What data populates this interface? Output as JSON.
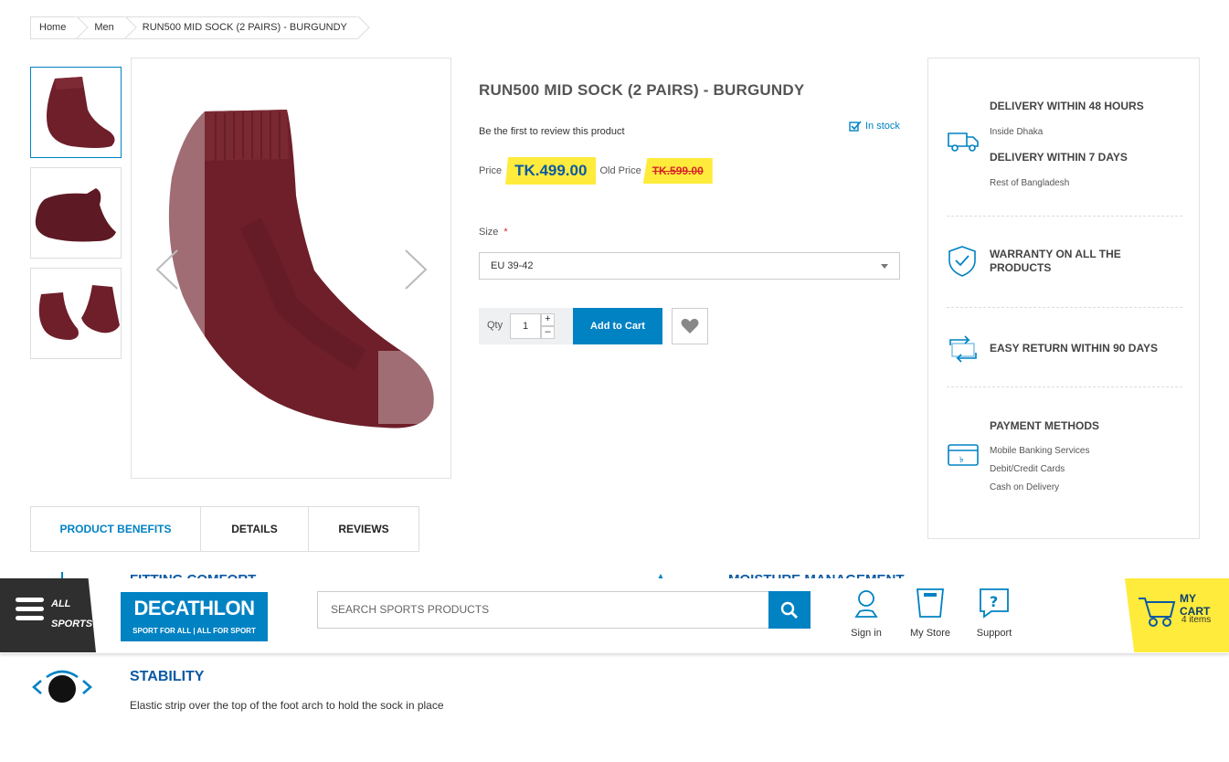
{
  "breadcrumb": {
    "home": "Home",
    "category": "Men",
    "current": "RUN500 MID SOCK (2 PAIRS) - BURGUNDY"
  },
  "product": {
    "title": "RUN500 MID SOCK (2 PAIRS) - BURGUNDY",
    "review_link": "Be the first to review this product",
    "stock": "In stock",
    "price_label": "Price",
    "price": "TK.499.00",
    "old_price_label": "Old Price",
    "old_price": "TK.599.00",
    "size_label": "Size",
    "size_required": "*",
    "size_value": "EU 39-42",
    "qty_label": "Qty",
    "qty_value": "1",
    "qty_plus": "+",
    "qty_minus": "–",
    "add_to_cart": "Add to Cart"
  },
  "info_panel": {
    "delivery_title_1": "DELIVERY WITHIN 48 HOURS",
    "delivery_sub_1": "Inside Dhaka",
    "delivery_title_2": "DELIVERY WITHIN 7 DAYS",
    "delivery_sub_2": "Rest of Bangladesh",
    "warranty_line_1": "WARRANTY ON ALL THE",
    "warranty_line_2": "PRODUCTS",
    "return_title": "EASY RETURN WITHIN 90 DAYS",
    "payment_title": "PAYMENT METHODS",
    "payment_methods": [
      "Mobile Banking Services",
      "Debit/Credit Cards",
      "Cash on Delivery"
    ]
  },
  "tabs": [
    {
      "label": "PRODUCT BENEFITS",
      "active": true
    },
    {
      "label": "DETAILS",
      "active": false
    },
    {
      "label": "REVIEWS",
      "active": false
    }
  ],
  "benefits_peek": {
    "left": "FITTING COMFORT",
    "right": "MOISTURE MANAGEMENT"
  },
  "header": {
    "all_sports_line_1": "ALL",
    "all_sports_line_2": "SPORTS",
    "logo_brand": "DECATHLON",
    "logo_tagline": "SPORT FOR ALL | ALL FOR SPORT",
    "search_placeholder": "SEARCH SPORTS PRODUCTS",
    "sign_in": "Sign in",
    "my_store": "My Store",
    "support": "Support",
    "cart_title": "MY CART",
    "cart_count": "4 items"
  },
  "stability": {
    "title": "STABILITY",
    "text": "Elastic strip over the top of the foot arch to hold the sock in place"
  },
  "colors": {
    "brand_blue": "#0082c3",
    "dark_blue": "#0b59a4",
    "price_yellow": "#ffeb3b",
    "sock_burgundy": "#6e1f2a"
  }
}
